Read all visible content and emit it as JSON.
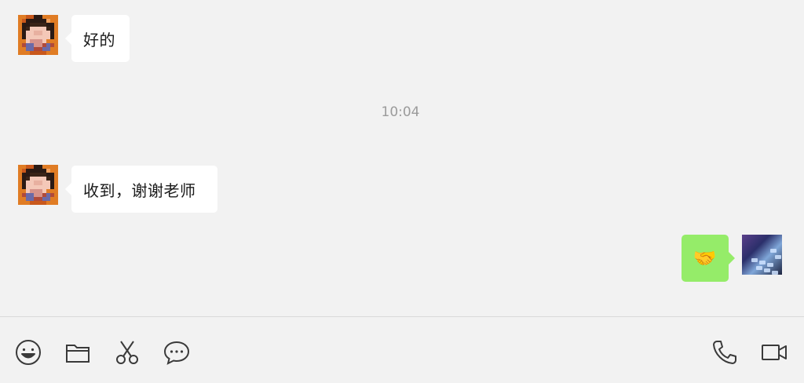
{
  "messages": [
    {
      "sender": "contact",
      "text": "好的"
    },
    {
      "sender": "contact",
      "text": "收到，谢谢老师"
    },
    {
      "sender": "me",
      "text": "🤝"
    }
  ],
  "timestamp": "10:04",
  "toolbar": {
    "left_icons": [
      "emoji-icon",
      "folder-icon",
      "scissors-icon",
      "chat-bubble-icon"
    ],
    "right_icons": [
      "phone-icon",
      "video-icon"
    ]
  },
  "colors": {
    "background": "#f2f2f2",
    "incoming_bubble": "#ffffff",
    "outgoing_bubble": "#95ec69",
    "timestamp_text": "#9b9b9b",
    "icon_stroke": "#3a3a3a"
  }
}
